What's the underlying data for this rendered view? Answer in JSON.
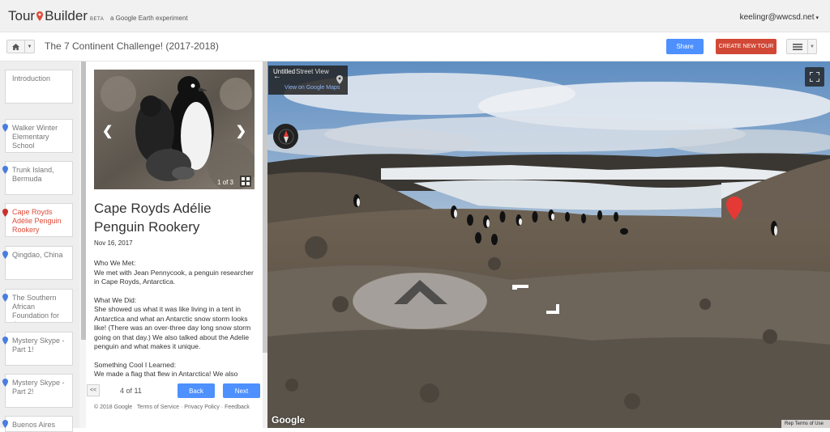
{
  "app": {
    "logo_text_left": "Tour",
    "logo_text_right": "Builder",
    "beta": "BETA",
    "experiment": "a Google Earth experiment",
    "user": "keelingr@wwcsd.net"
  },
  "toolbar": {
    "tour_title": "The 7 Continent Challenge! (2017-2018)",
    "share_label": "Share",
    "create_label": "CREATE NEW TOUR"
  },
  "sidebar": {
    "items": [
      {
        "label": "Introduction"
      },
      {
        "label": "Walker Winter Elementary School"
      },
      {
        "label": "Trunk Island, Bermuda"
      },
      {
        "label": "Cape Royds Adélie Penguin Rookery"
      },
      {
        "label": "Qingdao, China"
      },
      {
        "label": "The Southern African Foundation for the"
      },
      {
        "label": "Mystery Skype - Part 1!"
      },
      {
        "label": "Mystery Skype - Part 2!"
      },
      {
        "label": "Buenos Aires"
      }
    ]
  },
  "detail": {
    "photo_count": "1 of 3",
    "title": "Cape Royds Adélie Penguin Rookery",
    "date": "Nov 16, 2017",
    "who_heading": "Who We Met:",
    "who_text": "We met with Jean Pennycook, a penguin researcher in Cape Royds, Antarctica.",
    "what_heading": "What We Did:",
    "what_text": "She showed us what it was like living in a tent in Antarctica and what an Antarctic snow storm looks like! (There was an over-three day long snow storm going on that day.) We also talked about the Adelie penguin and what makes it unique.",
    "cool_heading": "Something Cool I Learned:",
    "cool_text": "We made a flag that flew in Antarctica! We also"
  },
  "pager": {
    "first": "<<",
    "indicator": "4 of 11",
    "back": "Back",
    "next": "Next"
  },
  "footer": {
    "copyright": "© 2018 Google",
    "sep": "·",
    "terms": "Terms of Service",
    "privacy": "Privacy Policy",
    "feedback": "Feedback"
  },
  "pano": {
    "info_title": "Untitled",
    "info_view": "Street View",
    "info_link": "View on Google Maps",
    "google": "Google",
    "report": "Rep",
    "terms": "Terms of Use"
  },
  "colors": {
    "blue_button": "#4d90fe",
    "red_button": "#d14836",
    "active_stop": "#dd4b39",
    "pin_blue": "#4a7de0",
    "pin_red": "#c9302c"
  }
}
